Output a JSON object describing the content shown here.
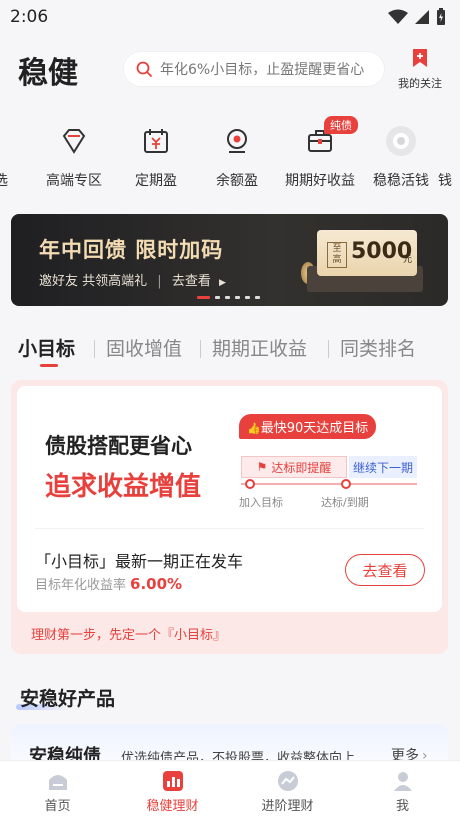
{
  "status": {
    "time": "2:06"
  },
  "header": {
    "title": "稳健",
    "search_placeholder": "年化6%小目标，止盈提醒更省心",
    "follow_label": "我的关注"
  },
  "categories": [
    {
      "label": "精选"
    },
    {
      "label": "高端专区"
    },
    {
      "label": "定期盈"
    },
    {
      "label": "余额盈"
    },
    {
      "label": "期期好收益",
      "badge": "纯债"
    },
    {
      "label": "稳稳活钱"
    },
    {
      "label": "钱"
    }
  ],
  "banner": {
    "headline": "年中回馈 限时加码",
    "sub": "邀好友 共领高端礼",
    "cta": "去查看",
    "voucher_tag": "至高",
    "voucher_amount": "5000",
    "voucher_unit": "元",
    "active_dot": 0,
    "dot_count": 6
  },
  "tabs": [
    {
      "label": "小目标",
      "active": true
    },
    {
      "label": "固收增值",
      "active": false
    },
    {
      "label": "期期正收益",
      "active": false
    },
    {
      "label": "同类排名",
      "active": false
    }
  ],
  "goal_card": {
    "line1": "债股搭配更省心",
    "line2": "追求收益增值",
    "fast_badge": "最快90天达成目标",
    "reminder": "达标即提醒",
    "next_period": "继续下一期",
    "label_join": "加入目标",
    "label_reach": "达标/到期",
    "issue_text": "「小目标」最新一期正在发车",
    "rate_label": "目标年化收益率",
    "rate_value": "6.00%",
    "button": "去查看",
    "footer": "理财第一步，先定一个『小目标』"
  },
  "section": {
    "title": "安稳好产品",
    "product_title": "安稳纯债",
    "product_desc": "优选纯债产品，不投股票，收益整体向上",
    "more": "更多"
  },
  "nav": [
    {
      "label": "首页",
      "active": false
    },
    {
      "label": "稳健理财",
      "active": true
    },
    {
      "label": "进阶理财",
      "active": false
    },
    {
      "label": "我",
      "active": false
    }
  ],
  "colors": {
    "accent": "#e8413d",
    "link_blue": "#3c5fd6"
  }
}
